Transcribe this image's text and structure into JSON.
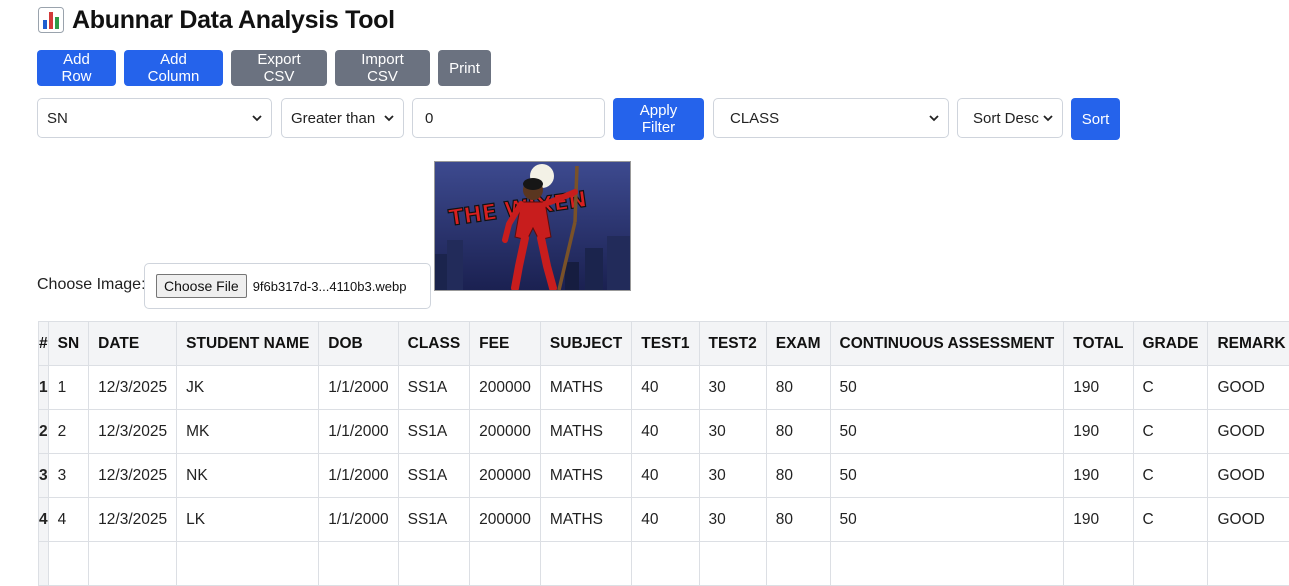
{
  "app": {
    "title": "Abunnar Data Analysis Tool",
    "title_icon": "bar-chart-icon"
  },
  "toolbar": {
    "add_row": "Add Row",
    "add_column": "Add Column",
    "export_csv": "Export CSV",
    "import_csv": "Import CSV",
    "print": "Print"
  },
  "filter": {
    "column": "SN",
    "operator": "Greater than",
    "value": "0",
    "apply": "Apply Filter"
  },
  "sort": {
    "column": "CLASS",
    "direction": "Sort Desc",
    "button": "Sort"
  },
  "image_picker": {
    "label": "Choose Image:",
    "button": "Choose File",
    "file_name": "9f6b317d-3...4110b3.webp",
    "preview_text": "THE WIXEN"
  },
  "table": {
    "headers": [
      "#",
      "SN",
      "DATE",
      "STUDENT NAME",
      "DOB",
      "CLASS",
      "FEE",
      "SUBJECT",
      "TEST1",
      "TEST2",
      "EXAM",
      "CONTINUOUS ASSESSMENT",
      "TOTAL",
      "GRADE",
      "REMARK"
    ],
    "delete_header_icon": "delete-column-icon",
    "rows": [
      {
        "index": "1",
        "cells": [
          "1",
          "12/3/2025",
          "JK",
          "1/1/2000",
          "SS1A",
          "200000",
          "MATHS",
          "40",
          "30",
          "80",
          "50",
          "190",
          "C",
          "GOOD"
        ]
      },
      {
        "index": "2",
        "cells": [
          "2",
          "12/3/2025",
          "MK",
          "1/1/2000",
          "SS1A",
          "200000",
          "MATHS",
          "40",
          "30",
          "80",
          "50",
          "190",
          "C",
          "GOOD"
        ]
      },
      {
        "index": "3",
        "cells": [
          "3",
          "12/3/2025",
          "NK",
          "1/1/2000",
          "SS1A",
          "200000",
          "MATHS",
          "40",
          "30",
          "80",
          "50",
          "190",
          "C",
          "GOOD"
        ]
      },
      {
        "index": "4",
        "cells": [
          "4",
          "12/3/2025",
          "LK",
          "1/1/2000",
          "SS1A",
          "200000",
          "MATHS",
          "40",
          "30",
          "80",
          "50",
          "190",
          "C",
          "GOOD"
        ]
      }
    ],
    "delete_symbol": "✕"
  },
  "colors": {
    "primary": "#2563eb",
    "secondary": "#6b7280",
    "danger": "#dc2626"
  }
}
